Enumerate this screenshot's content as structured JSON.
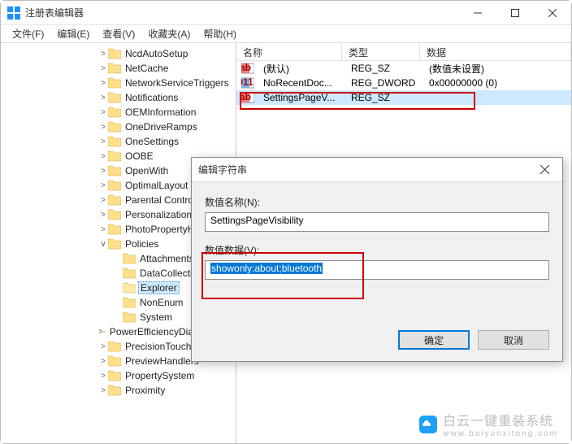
{
  "window": {
    "title": "注册表编辑器"
  },
  "menu": {
    "file": "文件(F)",
    "edit": "编辑(E)",
    "view": "查看(V)",
    "fav": "收藏夹(A)",
    "help": "帮助(H)"
  },
  "tree": [
    {
      "indent": 120,
      "chev": ">",
      "label": "NcdAutoSetup"
    },
    {
      "indent": 120,
      "chev": ">",
      "label": "NetCache"
    },
    {
      "indent": 120,
      "chev": ">",
      "label": "NetworkServiceTriggers"
    },
    {
      "indent": 120,
      "chev": ">",
      "label": "Notifications"
    },
    {
      "indent": 120,
      "chev": ">",
      "label": "OEMInformation"
    },
    {
      "indent": 120,
      "chev": ">",
      "label": "OneDriveRamps"
    },
    {
      "indent": 120,
      "chev": ">",
      "label": "OneSettings"
    },
    {
      "indent": 120,
      "chev": ">",
      "label": "OOBE"
    },
    {
      "indent": 120,
      "chev": ">",
      "label": "OpenWith"
    },
    {
      "indent": 120,
      "chev": ">",
      "label": "OptimalLayout"
    },
    {
      "indent": 120,
      "chev": ">",
      "label": "Parental Controls"
    },
    {
      "indent": 120,
      "chev": ">",
      "label": "Personalization"
    },
    {
      "indent": 120,
      "chev": ">",
      "label": "PhotoPropertyHandler"
    },
    {
      "indent": 120,
      "chev": "∨",
      "label": "Policies"
    },
    {
      "indent": 138,
      "chev": "",
      "label": "Attachments"
    },
    {
      "indent": 138,
      "chev": "",
      "label": "DataCollection"
    },
    {
      "indent": 138,
      "chev": "",
      "label": "Explorer",
      "selected": true,
      "open": true
    },
    {
      "indent": 138,
      "chev": "",
      "label": "NonEnum"
    },
    {
      "indent": 138,
      "chev": "",
      "label": "System"
    },
    {
      "indent": 120,
      "chev": ">",
      "label": "PowerEfficiencyDiagnostics"
    },
    {
      "indent": 120,
      "chev": ">",
      "label": "PrecisionTouchPad"
    },
    {
      "indent": 120,
      "chev": ">",
      "label": "PreviewHandlers"
    },
    {
      "indent": 120,
      "chev": ">",
      "label": "PropertySystem"
    },
    {
      "indent": 120,
      "chev": ">",
      "label": "Proximity"
    }
  ],
  "list": {
    "headers": {
      "name": "名称",
      "type": "类型",
      "data": "数据"
    },
    "rows": [
      {
        "icon": "str",
        "name": "(默认)",
        "type": "REG_SZ",
        "data": "(数值未设置)"
      },
      {
        "icon": "bin",
        "name": "NoRecentDoc...",
        "type": "REG_DWORD",
        "data": "0x00000000 (0)"
      },
      {
        "icon": "str",
        "name": "SettingsPageV...",
        "type": "REG_SZ",
        "data": "",
        "highlight": true
      }
    ]
  },
  "dialog": {
    "title": "编辑字符串",
    "name_label": "数值名称(N):",
    "name_value": "SettingsPageVisibility",
    "data_label": "数值数据(V):",
    "data_value": "showonly:about;bluetooth",
    "ok": "确定",
    "cancel": "取消"
  },
  "watermark": {
    "text": "白云一键重装系统",
    "url": "www.baiyunxitong.com"
  }
}
